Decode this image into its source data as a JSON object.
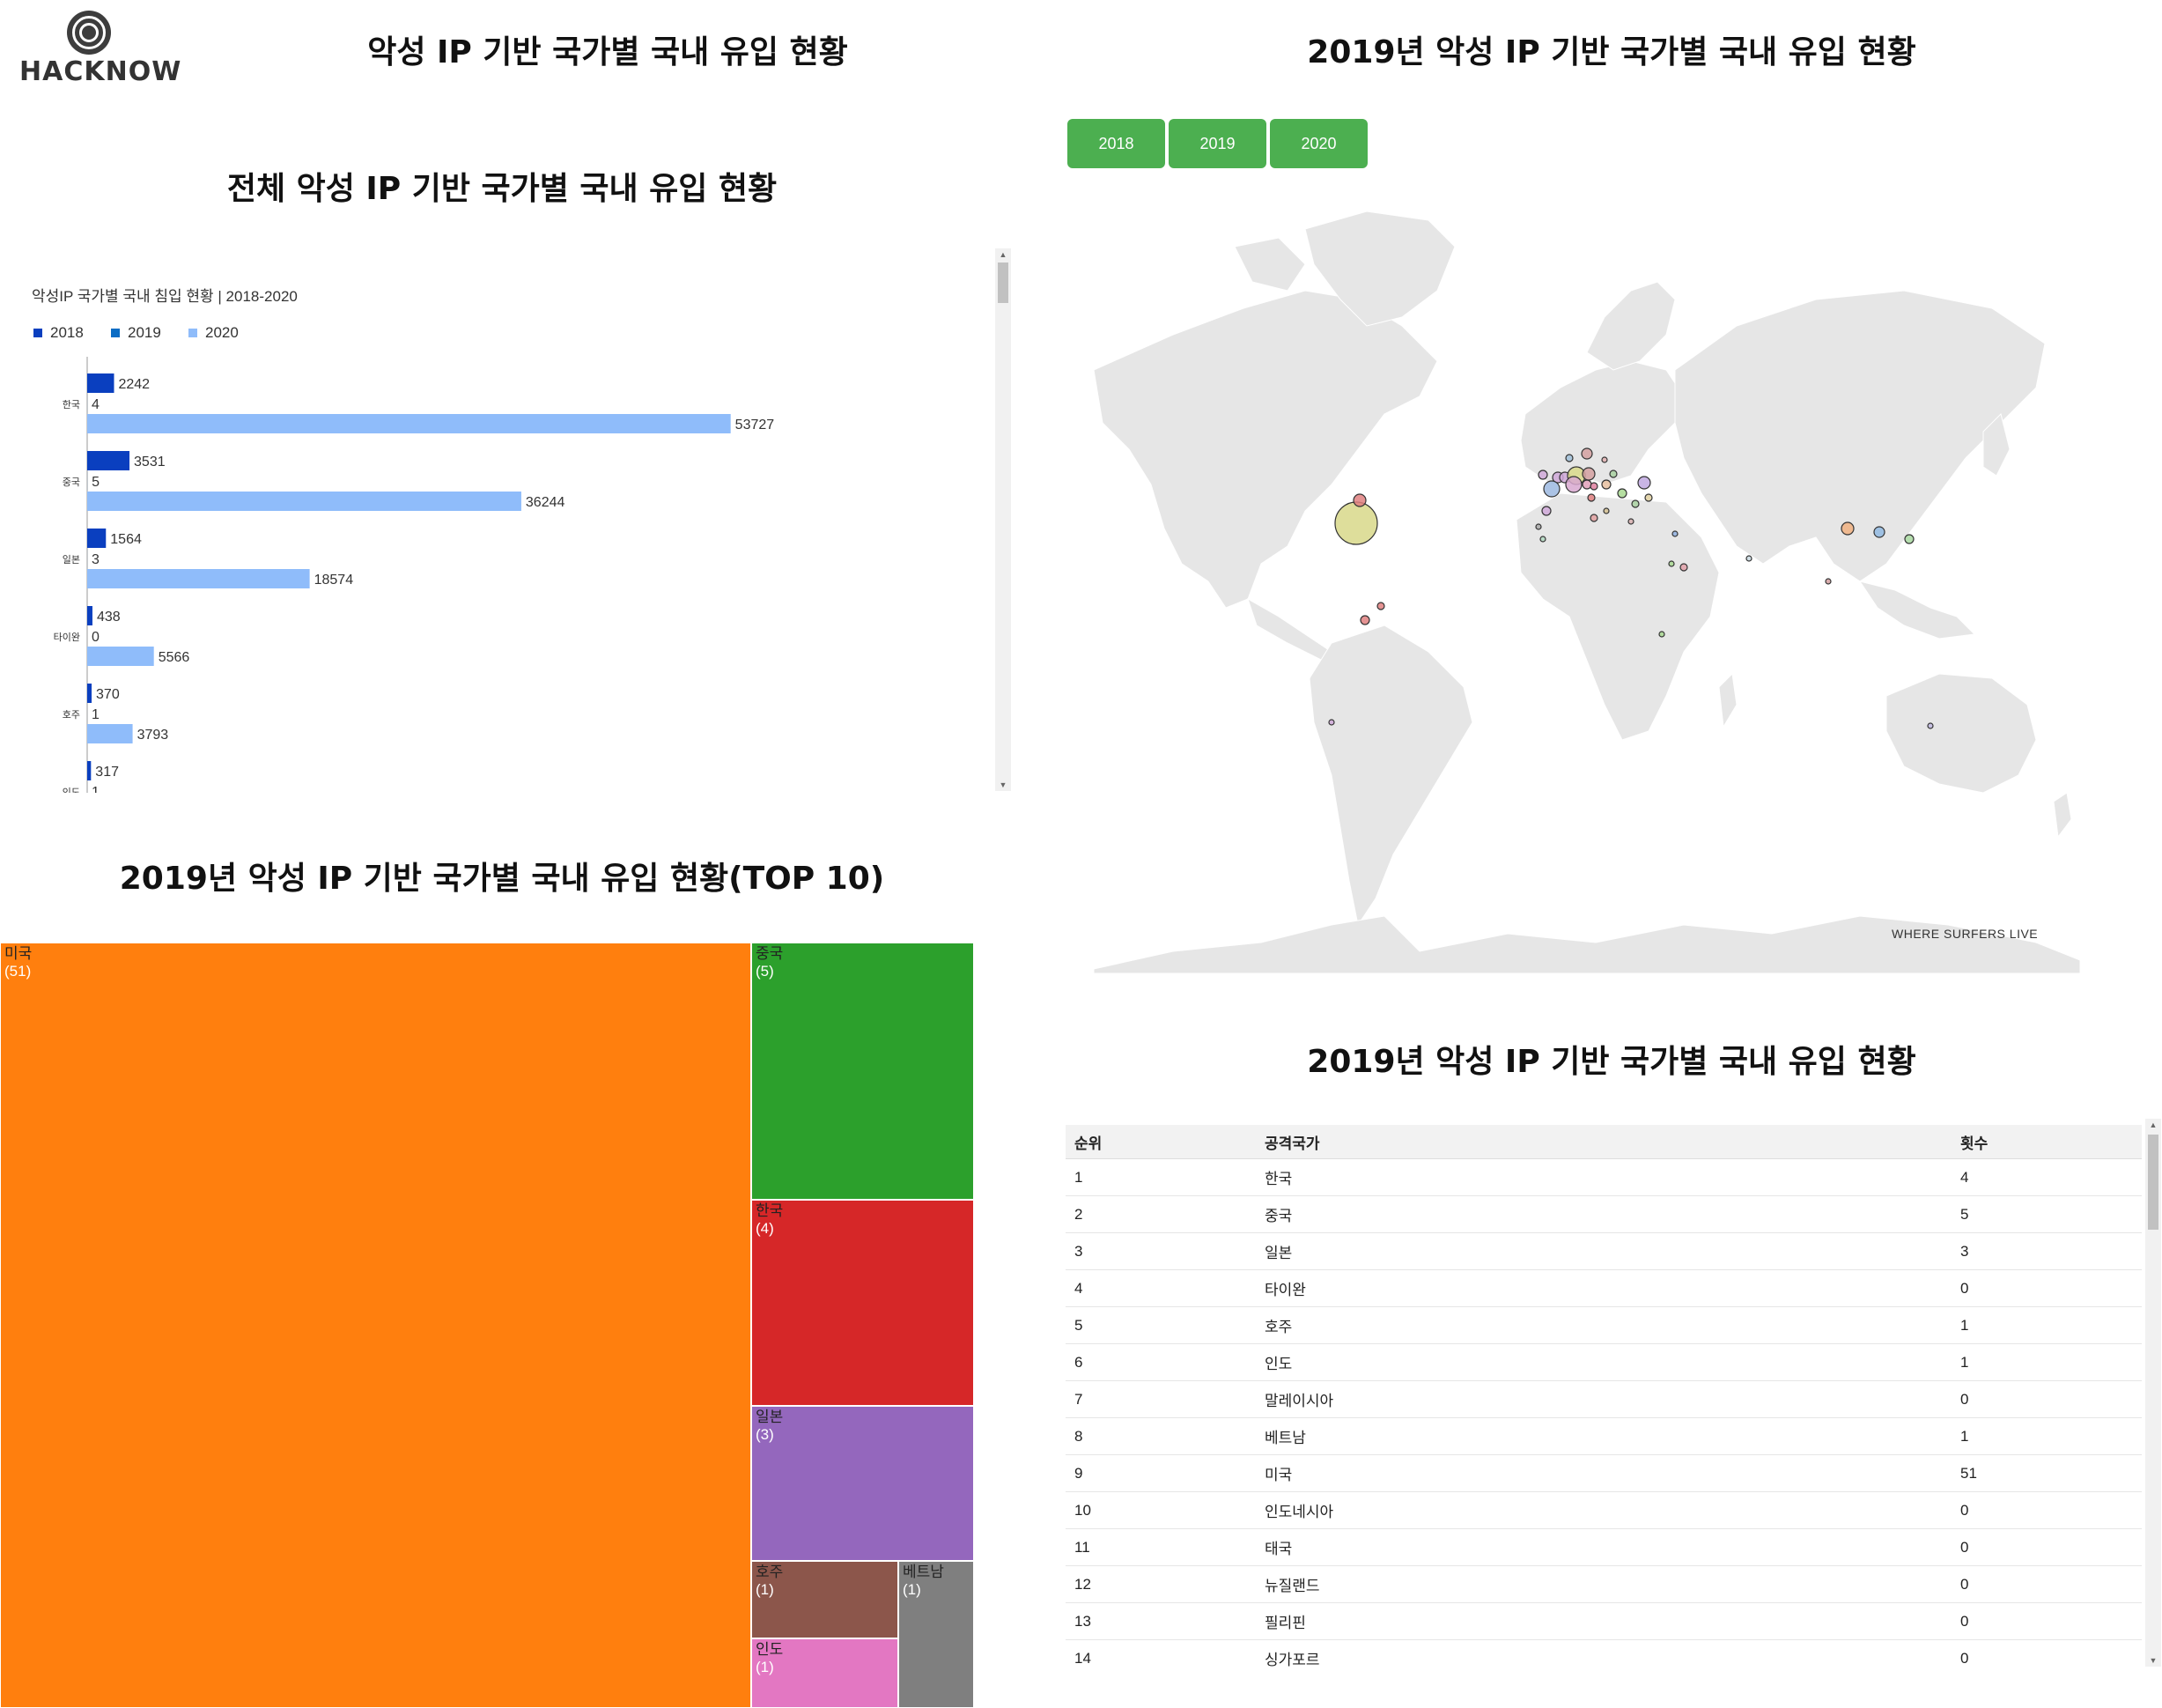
{
  "brand": {
    "logo_text": "HACKNOW"
  },
  "titles": {
    "main": "악성 IP 기반 국가별 국내 유입 현황",
    "overall": "전체 악성 IP 기반 국가별 국내 유입 현황",
    "map": "2019년 악성 IP 기반 국가별 국내 유입 현황",
    "treemap": "2019년 악성 IP 기반 국가별 국내 유입 현황(TOP 10)",
    "table": "2019년 악성 IP 기반 국가별 국내 유입 현황"
  },
  "year_buttons": [
    "2018",
    "2019",
    "2020"
  ],
  "map_credit": "WHERE SURFERS LIVE",
  "chart_data": [
    {
      "type": "bar",
      "orientation": "horizontal",
      "title": "악성IP 국가별 국내 침입 현황 | 2018-2020",
      "legend_position": "top-left",
      "categories": [
        "한국",
        "중국",
        "일본",
        "타이완",
        "호주",
        "인도"
      ],
      "series": [
        {
          "name": "2018",
          "color": "#0a3fbf",
          "values": [
            2242,
            3531,
            1564,
            438,
            370,
            317
          ]
        },
        {
          "name": "2019",
          "color": "#0a6cc4",
          "values": [
            4,
            5,
            3,
            0,
            1,
            1
          ]
        },
        {
          "name": "2020",
          "color": "#8fbcfa",
          "values": [
            53727,
            36244,
            18574,
            5566,
            3793,
            null
          ]
        }
      ],
      "xlim": [
        0,
        60000
      ],
      "grid": false
    },
    {
      "type": "treemap",
      "title": "2019년 악성 IP 기반 국가별 국내 유입 현황(TOP 10)",
      "items": [
        {
          "name": "미국",
          "value": "(51)",
          "color": "#ff7f0e"
        },
        {
          "name": "중국",
          "value": "(5)",
          "color": "#2ca02c"
        },
        {
          "name": "한국",
          "value": "(4)",
          "color": "#d62728"
        },
        {
          "name": "일본",
          "value": "(3)",
          "color": "#9467bd"
        },
        {
          "name": "호주",
          "value": "(1)",
          "color": "#8c564b"
        },
        {
          "name": "베트남",
          "value": "(1)",
          "color": "#7f7f7f"
        },
        {
          "name": "인도",
          "value": "(1)",
          "color": "#e377c2"
        }
      ]
    },
    {
      "type": "table",
      "columns": [
        "순위",
        "공격국가",
        "횟수"
      ],
      "rows": [
        [
          "1",
          "한국",
          "4"
        ],
        [
          "2",
          "중국",
          "5"
        ],
        [
          "3",
          "일본",
          "3"
        ],
        [
          "4",
          "타이완",
          "0"
        ],
        [
          "5",
          "호주",
          "1"
        ],
        [
          "6",
          "인도",
          "1"
        ],
        [
          "7",
          "말레이시아",
          "0"
        ],
        [
          "8",
          "베트남",
          "1"
        ],
        [
          "9",
          "미국",
          "51"
        ],
        [
          "10",
          "인도네시아",
          "0"
        ],
        [
          "11",
          "태국",
          "0"
        ],
        [
          "12",
          "뉴질랜드",
          "0"
        ],
        [
          "13",
          "필리핀",
          "0"
        ],
        [
          "14",
          "싱가포르",
          "0"
        ]
      ]
    }
  ]
}
